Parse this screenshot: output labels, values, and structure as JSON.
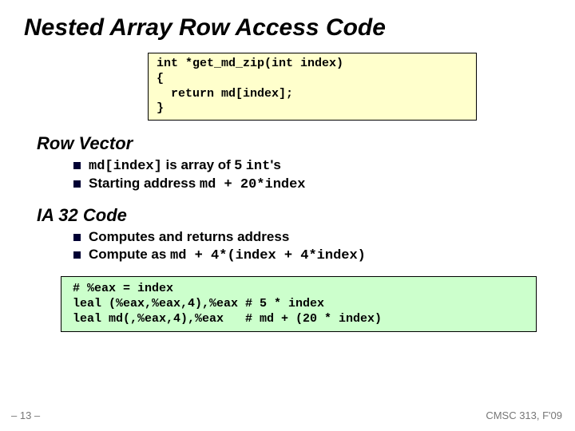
{
  "title": "Nested Array Row Access Code",
  "code1": "int *get_md_zip(int index)\n{\n  return md[index];\n}",
  "section1": {
    "heading": "Row Vector",
    "b1_mono": "md[index]",
    "b1_rest": " is array of 5 ",
    "b1_mono2": "int",
    "b1_tail": "'s",
    "b2_text": "Starting address ",
    "b2_mono": "md + 20*index"
  },
  "section2": {
    "heading": "IA 32 Code",
    "b1": "Computes and returns address",
    "b2_text": "Compute as     ",
    "b2_mono": "md + 4*(index + 4*index)"
  },
  "code2": "# %eax = index\nleal (%eax,%eax,4),%eax # 5 * index\nleal md(,%eax,4),%eax   # md + (20 * index)",
  "pagenum": "– 13 –",
  "course": "CMSC 313, F'09"
}
